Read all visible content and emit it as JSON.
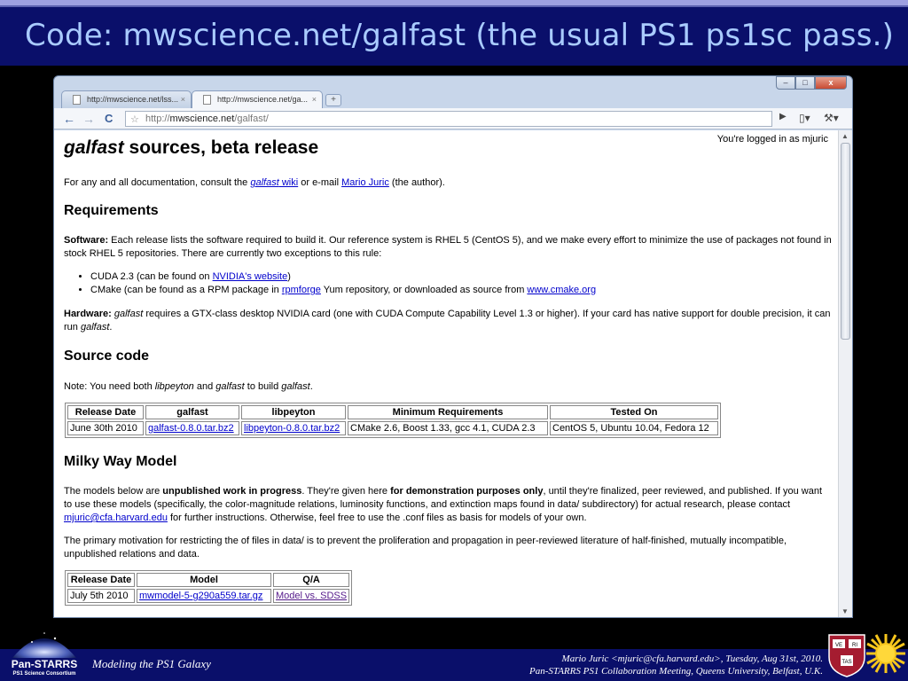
{
  "slide": {
    "title": "Code: mwscience.net/galfast  (the usual PS1 ps1sc pass.)",
    "footer_left": "Modeling the PS1 Galaxy",
    "footer_right_line1": "Mario Juric <mjuric@cfa.harvard.edu>, Tuesday, Aug 31st, 2010.",
    "footer_right_line2": "Pan-STARRS PS1 Collaboration Meeting, Queens University, Belfast, U.K.",
    "logo_text": "Pan-STARRS",
    "logo_subtext": "PS1 Science Consortium",
    "harvard_shield_text": [
      "VE",
      "RI",
      "TAS"
    ]
  },
  "browser": {
    "tabs": [
      {
        "label": "http://mwscience.net/lss...",
        "active": false,
        "close": "×"
      },
      {
        "label": "http://mwscience.net/ga...",
        "active": true,
        "close": "×"
      }
    ],
    "new_tab": "+",
    "url_prefix": "http://",
    "url_host": "mwscience.net",
    "url_path": "/galfast/",
    "win_buttons": {
      "min": "–",
      "max": "□",
      "close": "x"
    },
    "icons": {
      "back": "←",
      "forward": "→",
      "reload": "C",
      "star": "☆",
      "go": "▶",
      "page": "▯▾",
      "wrench": "⚒▾"
    }
  },
  "page": {
    "logged_in": "You're logged in as mjuric",
    "title_italic": "galfast",
    "title_rest": " sources, beta release",
    "intro": {
      "t1": "For any and all documentation, consult the ",
      "link_wiki_italic": "galfast",
      "link_wiki_rest": " wiki",
      "t2": " or e-mail ",
      "link_author": "Mario Juric",
      "t3": " (the author)."
    },
    "requirements": {
      "heading": "Requirements",
      "software_label": "Software:",
      "software_text": " Each release lists the software required to build it. Our reference system is RHEL 5 (CentOS 5), and we make every effort to minimize the use of packages not found in stock RHEL 5 repositories. There are currently two exceptions to this rule:",
      "cuda_text": "CUDA 2.3 (can be found on ",
      "cuda_link": "NVIDIA's website",
      "cuda_end": ")",
      "cmake_text": "CMake (can be found as a RPM package in ",
      "cmake_link1": "rpmforge",
      "cmake_mid": " Yum repository, or downloaded as source from ",
      "cmake_link2": "www.cmake.org",
      "hardware_label": "Hardware:",
      "hardware_italic": " galfast",
      "hardware_text": " requires a GTX-class desktop NVIDIA card (one with CUDA Compute Capability Level 1.3 or higher). If your card has native support for double precision, it can run ",
      "hardware_italic2": "galfast",
      "hardware_end": "."
    },
    "source": {
      "heading": "Source code",
      "note1": "Note: You need both ",
      "note_i1": "libpeyton",
      "note2": " and ",
      "note_i2": "galfast",
      "note3": " to build ",
      "note_i3": "galfast",
      "note4": ".",
      "headers": [
        "Release Date",
        "galfast",
        "libpeyton",
        "Minimum Requirements",
        "Tested On"
      ],
      "rows": [
        [
          "June 30th 2010",
          "galfast-0.8.0.tar.bz2",
          "libpeyton-0.8.0.tar.bz2",
          "CMake 2.6, Boost 1.33, gcc 4.1, CUDA 2.3",
          "CentOS 5, Ubuntu 10.04, Fedora 12"
        ]
      ]
    },
    "milkyway": {
      "heading": "Milky Way Model",
      "p1_a": "The models below are ",
      "p1_b": "unpublished work in progress",
      "p1_c": ". They're given here ",
      "p1_d": "for demonstration purposes only",
      "p1_e": ", until they're finalized, peer reviewed, and published. If you want to use these models (specifically, the color-magnitude relations, luminosity functions, and extinction maps found in data/ subdirectory) for actual research, please contact ",
      "p1_link": "mjuric@cfa.harvard.edu",
      "p1_f": " for further instructions. Otherwise, feel free to use the .conf files as basis for models of your own.",
      "p2": "The primary motivation for restricting the of files in data/ is to prevent the proliferation and propagation in peer-reviewed literature of half-finished, mutually incompatible, unpublished relations and data.",
      "headers": [
        "Release Date",
        "Model",
        "Q/A"
      ],
      "rows": [
        [
          "July 5th 2010",
          "mwmodel-5-g290a559.tar.gz",
          "Model vs. SDSS"
        ]
      ]
    }
  }
}
